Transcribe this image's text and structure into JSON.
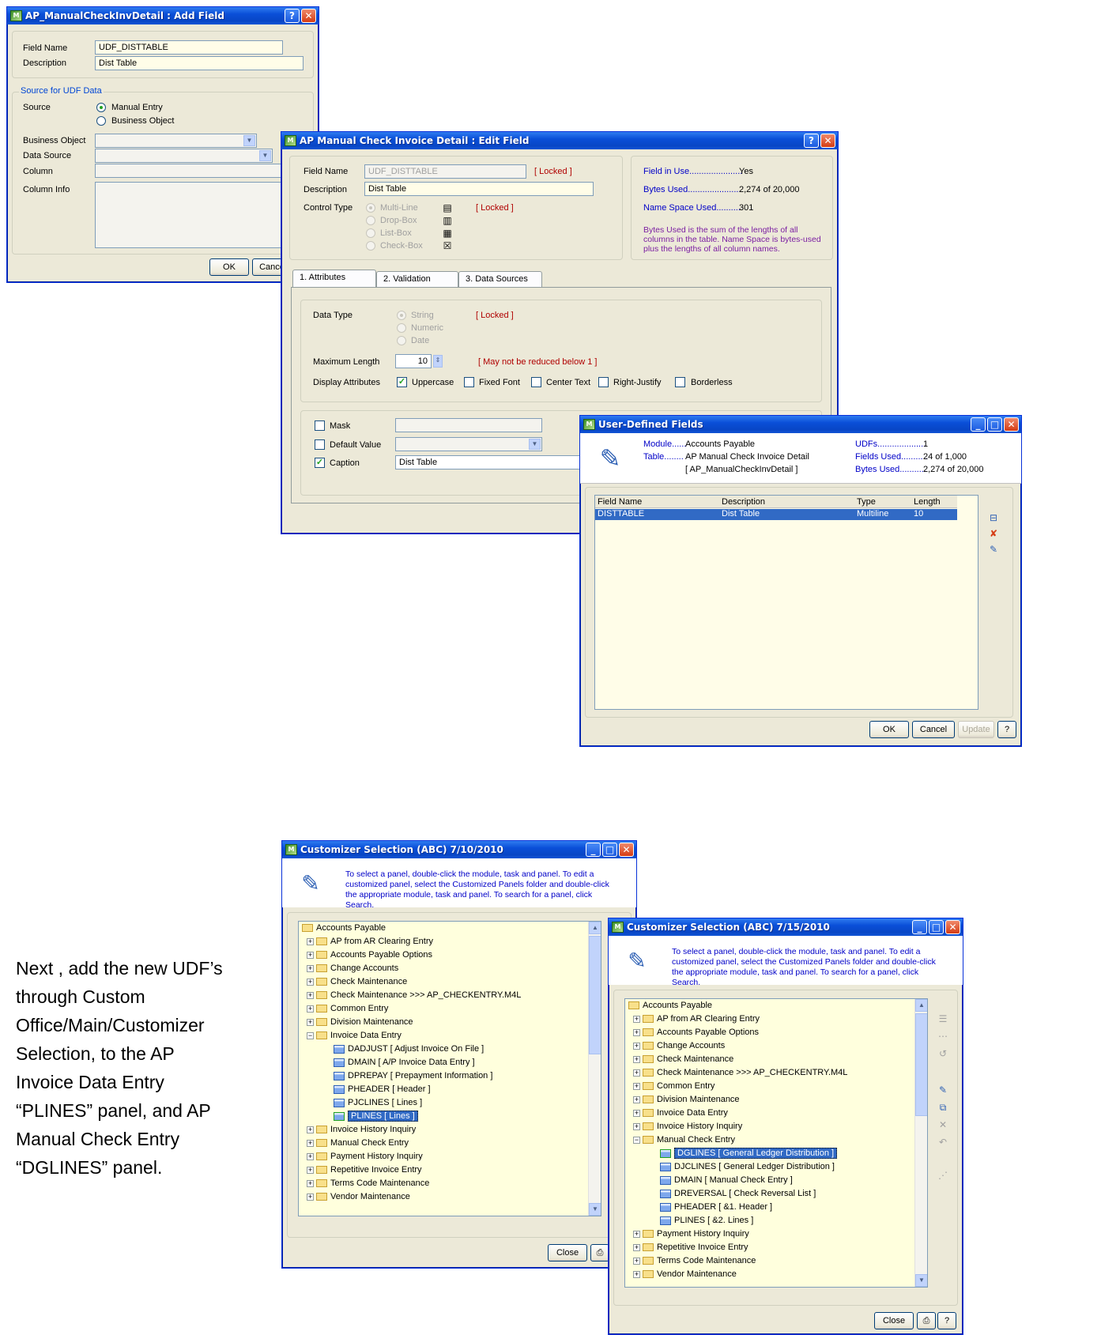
{
  "add_field": {
    "title": "AP_ManualCheckInvDetail : Add Field",
    "field_name_label": "Field Name",
    "field_name_value": "UDF_DISTTABLE",
    "description_label": "Description",
    "description_value": "Dist Table",
    "source_group": "Source for UDF Data",
    "source_label": "Source",
    "source_options": [
      "Manual Entry",
      "Business Object"
    ],
    "business_object_label": "Business Object",
    "data_source_label": "Data Source",
    "column_label": "Column",
    "column_info_label": "Column Info",
    "ok": "OK",
    "cancel": "Cance"
  },
  "edit_field": {
    "title": "AP Manual Check Invoice Detail : Edit  Field",
    "field_name_label": "Field Name",
    "field_name_value": "UDF_DISTTABLE",
    "locked": "[ Locked ]",
    "description_label": "Description",
    "description_value": "Dist Table",
    "control_type_label": "Control Type",
    "control_types": [
      "Multi-Line",
      "Drop-Box",
      "List-Box",
      "Check-Box"
    ],
    "field_in_use_label": "Field in Use......................",
    "field_in_use_value": "Yes",
    "bytes_used_label": "Bytes Used......................",
    "bytes_used_value": "2,274 of 20,000",
    "name_space_label": "Name Space Used..........",
    "name_space_value": "301",
    "bytes_note": "Bytes Used is the sum of the lengths of all columns in the table.  Name Space is bytes-used plus the lengths of all column names.",
    "tabs": [
      "1. Attributes",
      "2. Validation",
      "3. Data Sources"
    ],
    "data_type_label": "Data Type",
    "data_types": [
      "String",
      "Numeric",
      "Date"
    ],
    "max_length_label": "Maximum Length",
    "max_length_value": "10",
    "max_length_note": "[ May not be reduced below 1 ]",
    "display_attr_label": "Display Attributes",
    "display_attrs": [
      "Uppercase",
      "Fixed Font",
      "Center Text",
      "Right-Justify",
      "Borderless"
    ],
    "mask_label": "Mask",
    "default_value_label": "Default Value",
    "caption_label": "Caption",
    "caption_value": "Dist Table"
  },
  "udf": {
    "title": "User-Defined Fields",
    "module_label": "Module......",
    "module_value": "Accounts Payable",
    "table_label": "Table........",
    "table_value": "AP Manual Check Invoice Detail",
    "table_value2": "[ AP_ManualCheckInvDetail ]",
    "udfs_label": "UDFs....................",
    "udfs_value": "1",
    "fields_used_label": "Fields Used...........",
    "fields_used_value": "24 of 1,000",
    "bytes_used_label": "Bytes Used...........",
    "bytes_used_value": "2,274 of 20,000",
    "columns": [
      "Field Name",
      "Description",
      "Type",
      "Length"
    ],
    "row": [
      "DISTTABLE",
      "Dist Table",
      "Multiline",
      "10"
    ],
    "ok": "OK",
    "cancel": "Cancel",
    "update": "Update"
  },
  "cust1": {
    "title": "Customizer Selection (ABC) 7/10/2010",
    "instructions": "To select a panel, double-click the module, task and panel. To edit a customized panel, select the Customized Panels folder and double-click the appropriate module, task and panel. To search for a panel, click Search.",
    "root": "Accounts Payable",
    "items_before": [
      "AP from AR Clearing Entry",
      "Accounts Payable Options",
      "Change Accounts",
      "Check Maintenance",
      "Check Maintenance >>> AP_CHECKENTRY.M4L",
      "Common Entry",
      "Division Maintenance"
    ],
    "open_folder": "Invoice Data Entry",
    "panels": [
      "DADJUST   [ Adjust Invoice On File ]",
      "DMAIN   [ A/P Invoice Data Entry ]",
      "DPREPAY   [ Prepayment Information ]",
      "PHEADER   [ Header ]",
      "PJCLINES   [ Lines ]"
    ],
    "selected_panel": "PLINES   [ Lines ]",
    "items_after": [
      "Invoice History Inquiry",
      "Manual Check Entry",
      "Payment History Inquiry",
      "Repetitive Invoice Entry",
      "Terms Code Maintenance",
      "Vendor Maintenance"
    ],
    "close": "Close"
  },
  "cust2": {
    "title": "Customizer Selection (ABC) 7/15/2010",
    "instructions": "To select a panel, double-click the module, task and panel. To edit a customized panel, select the Customized Panels folder and double-click the appropriate module, task and panel. To search for a panel, click Search.",
    "root": "Accounts Payable",
    "items_before": [
      "AP from AR Clearing Entry",
      "Accounts Payable Options",
      "Change Accounts",
      "Check Maintenance",
      "Check Maintenance >>> AP_CHECKENTRY.M4L",
      "Common Entry",
      "Division Maintenance",
      "Invoice Data Entry",
      "Invoice History Inquiry"
    ],
    "open_folder": "Manual Check Entry",
    "selected_panel": "DGLINES   [ General Ledger Distribution ]",
    "panels": [
      "DJCLINES   [ General Ledger Distribution ]",
      "DMAIN   [ Manual Check Entry ]",
      "DREVERSAL   [ Check Reversal List ]",
      "PHEADER   [ &1. Header ]",
      "PLINES   [ &2. Lines ]"
    ],
    "items_after": [
      "Payment History Inquiry",
      "Repetitive Invoice Entry",
      "Terms Code Maintenance",
      "Vendor Maintenance"
    ],
    "close": "Close"
  },
  "caption": "Next , add the new UDF’s through Custom Office/Main/Customizer Selection, to the AP Invoice Data Entry “PLINES” panel, and AP Manual Check Entry “DGLINES” panel.",
  "caption_lines": [
    "Next , add the new UDF’s",
    "through Custom",
    "Office/Main/Customizer",
    "Selection, to the AP",
    "Invoice Data Entry",
    "“PLINES” panel, and AP",
    "Manual Check Entry",
    "“DGLINES” panel."
  ]
}
